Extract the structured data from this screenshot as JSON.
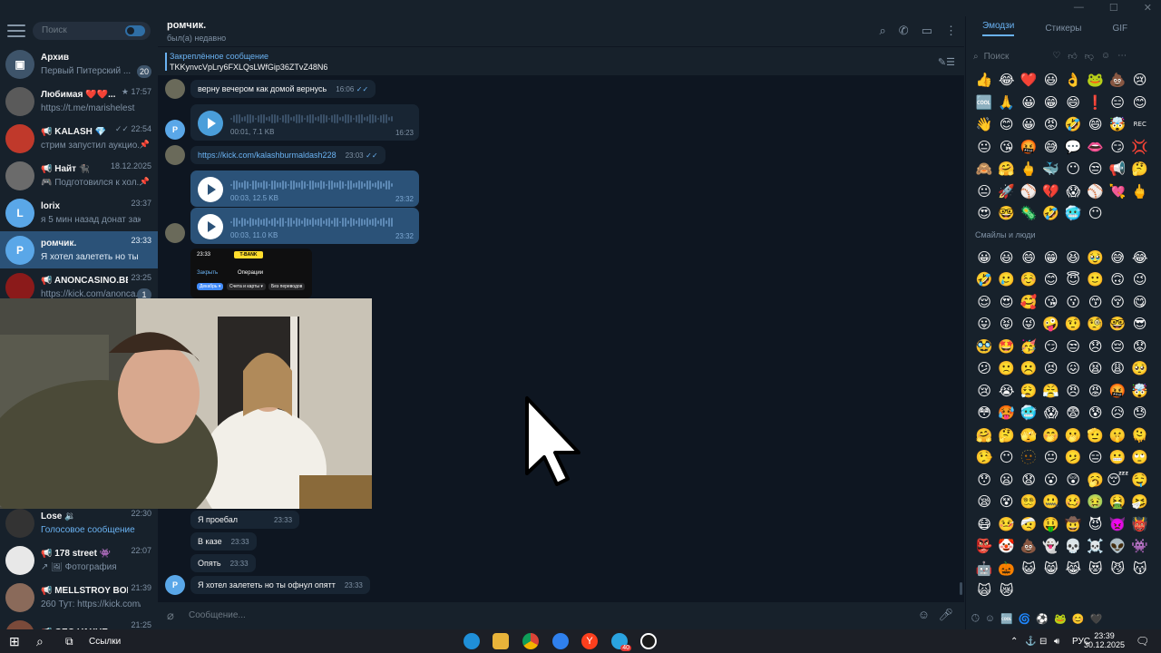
{
  "sidebar": {
    "search_placeholder": "Поиск",
    "chats": [
      {
        "name": "Архив",
        "preview": "Первый Питерский ...",
        "time": "",
        "badge": "20",
        "avatar_color": "#3e546a",
        "avatar_letter": "▣"
      },
      {
        "name": "Любимая ❤️❤️...",
        "preview": "https://t.me/marishelest",
        "time": "★ 17:57",
        "badge": "",
        "avatar_color": "#5a5a5a",
        "avatar_letter": ""
      },
      {
        "name": "📢 KALASH 💎",
        "preview": "стрим запустил аукцио...",
        "time": "✓✓ 22:54",
        "badge": "",
        "pin": "📌",
        "avatar_color": "#c0392b",
        "avatar_letter": ""
      },
      {
        "name": "📢 Найт 🐈‍⬛",
        "preview": "🎮 Подготовился к хол...",
        "time": "18.12.2025",
        "badge": "",
        "pin": "📌",
        "avatar_color": "#6b6b6b",
        "avatar_letter": ""
      },
      {
        "name": "lorix",
        "preview": "я 5 мин назад донат закину...",
        "time": "23:37",
        "badge": "",
        "avatar_color": "#5aa7e8",
        "avatar_letter": "L"
      },
      {
        "name": "ромчик.",
        "preview": "Я хотел залететь но ты офн...",
        "time": "23:33",
        "badge": "",
        "avatar_color": "#5aa7e8",
        "avatar_letter": "Р",
        "active": true
      },
      {
        "name": "📢 ANONCASINO.BET",
        "preview": "https://kick.com/anonca...",
        "time": "23:25",
        "badge": "1",
        "avatar_color": "#8b1a1a",
        "avatar_letter": ""
      }
    ],
    "lower_chats": [
      {
        "name": "Lose 🔉",
        "preview": "Голосовое сообщение",
        "time": "22:30",
        "avatar_color": "#333333"
      },
      {
        "name": "📢 178 street 👾",
        "preview": "↗ 🖼 Фотография",
        "time": "22:07",
        "avatar_color": "#e8e8e8"
      },
      {
        "name": "📢 MELLSTROY BONUS",
        "preview": "260 Тут: https://kick.com/m...",
        "time": "21:39",
        "avatar_color": "#8a6a5a"
      },
      {
        "name": "📢 GEO VAXUE",
        "preview": "",
        "time": "21:25",
        "avatar_color": "#7a4a3a"
      }
    ]
  },
  "header": {
    "name": "ромчик.",
    "status": "был(а) недавно"
  },
  "pinned": {
    "title": "Закреплённое сообщение",
    "text": "TKKynvcVpLry6FXLQsLWfGip36ZTvZ48N6"
  },
  "messages": {
    "m1": {
      "text": "верну вечером как домой вернусь",
      "time": "16:06"
    },
    "v1": {
      "meta": "00:01, 7.1 KB",
      "time": "16:23"
    },
    "m2": {
      "text": "https://kick.com/kalashburmaldash228",
      "time": "23:03"
    },
    "v2": {
      "meta": "00:03, 12.5 KB",
      "time": "23:32"
    },
    "v3": {
      "meta": "00:03, 11.0 KB",
      "time": "23:32"
    },
    "img": {
      "time_label": "23:33",
      "bank": "T-BANK",
      "close": "Закрыть",
      "ops": "Операции",
      "chip1": "Декабрь ▾",
      "chip2": "Счета и карты ▾",
      "chip3": "Без переводов"
    },
    "m3": {
      "text": "Я проебал",
      "time": "23:33"
    },
    "m4": {
      "text": "В казе",
      "time": "23:33"
    },
    "m5": {
      "text": "Опять",
      "time": "23:33"
    },
    "m6": {
      "text": "Я хотел залететь но ты офнул опятт",
      "time": "23:33"
    }
  },
  "input": {
    "placeholder": "Сообщение..."
  },
  "emoji_panel": {
    "tabs": [
      "Эмодзи",
      "Стикеры",
      "GIF"
    ],
    "search_placeholder": "Поиск",
    "section_title": "Смайлы и люди",
    "recent": [
      "👍",
      "😂",
      "❤️",
      "😃",
      "👌",
      "🐸",
      "💩",
      "😢",
      "🆒",
      "🙏",
      "😀",
      "😁",
      "😄",
      "❗",
      "😑",
      "😊",
      "👋",
      "😊",
      "😀",
      "😡",
      "🤣",
      "😄",
      "🤯",
      "REC",
      "😐",
      "😘",
      "🤬",
      "😅",
      "💬",
      "👄",
      "😏",
      "💢",
      "🙈",
      "🤗",
      "🖕",
      "🐳",
      "😶",
      "😒",
      "📢",
      "🤔",
      "😐",
      "🚀",
      "⚾",
      "💔",
      "😱",
      "⚾",
      "💘",
      "🖕",
      "😍",
      "🤓",
      "🦠",
      "🤣",
      "🥶",
      "😶"
    ],
    "people": [
      "😀",
      "😃",
      "😄",
      "😁",
      "😆",
      "🥹",
      "😅",
      "😂",
      "🤣",
      "🥲",
      "☺️",
      "😊",
      "😇",
      "🙂",
      "🙃",
      "😉",
      "😌",
      "😍",
      "🥰",
      "😘",
      "😗",
      "😙",
      "😚",
      "😋",
      "😛",
      "😝",
      "😜",
      "🤪",
      "🤨",
      "🧐",
      "🤓",
      "😎",
      "🥸",
      "🤩",
      "🥳",
      "😏",
      "😒",
      "😞",
      "😔",
      "😟",
      "😕",
      "🙁",
      "☹️",
      "😣",
      "😖",
      "😫",
      "😩",
      "🥺",
      "😢",
      "😭",
      "😮‍💨",
      "😤",
      "😠",
      "😡",
      "🤬",
      "🤯",
      "😳",
      "🥵",
      "🥶",
      "😱",
      "😨",
      "😰",
      "😥",
      "😓",
      "🤗",
      "🤔",
      "🫣",
      "🤭",
      "🫢",
      "🫡",
      "🤫",
      "🫠",
      "🤥",
      "😶",
      "🫥",
      "😐",
      "🫤",
      "😑",
      "😬",
      "🙄",
      "😯",
      "😦",
      "😧",
      "😮",
      "😲",
      "🥱",
      "😴",
      "🤤",
      "😪",
      "😵",
      "😵‍💫",
      "🤐",
      "🥴",
      "🤢",
      "🤮",
      "🤧",
      "😷",
      "🤒",
      "🤕",
      "🤑",
      "🤠",
      "😈",
      "👿",
      "👹",
      "👺",
      "🤡",
      "💩",
      "👻",
      "💀",
      "☠️",
      "👽",
      "👾",
      "🤖",
      "🎃",
      "😺",
      "😸",
      "😹",
      "😻",
      "😼",
      "😽",
      "🙀",
      "😿"
    ]
  },
  "taskbar": {
    "links": "Ссылки",
    "lang": "РУС",
    "time": "23:39",
    "date": "30.12.2025",
    "telegram_badge": "40"
  }
}
